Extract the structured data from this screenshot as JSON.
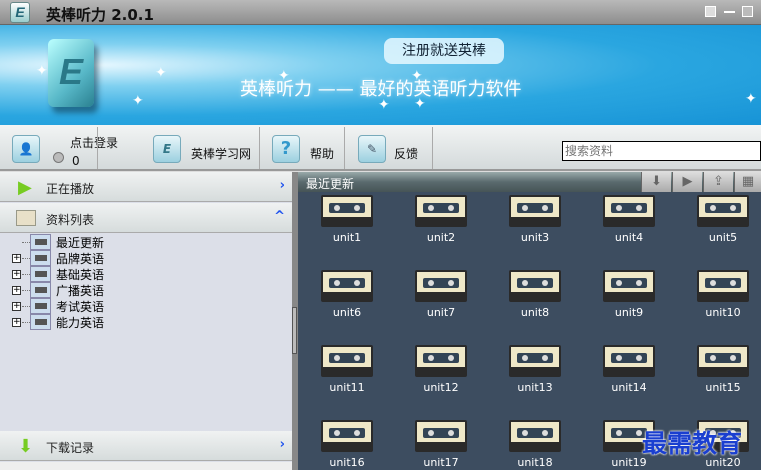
{
  "window": {
    "title": "英棒听力 2.0.1"
  },
  "banner": {
    "promo": "注册就送英棒",
    "slogan": "英棒听力 —— 最好的英语听力软件"
  },
  "toolbar": {
    "login": "点击登录",
    "coins": "0",
    "site": "英棒学习网",
    "help": "帮助",
    "feedback": "反馈",
    "search_placeholder": "搜索资料"
  },
  "left": {
    "now_playing": "正在播放",
    "resource_list": "资料列表",
    "downloads": "下载记录",
    "tree": [
      "最近更新",
      "品牌英语",
      "基础英语",
      "广播英语",
      "考试英语",
      "能力英语"
    ]
  },
  "right": {
    "title": "最近更新",
    "units": [
      "unit1",
      "unit2",
      "unit3",
      "unit4",
      "unit5",
      "unit6",
      "unit7",
      "unit8",
      "unit9",
      "unit10",
      "unit11",
      "unit12",
      "unit13",
      "unit14",
      "unit15",
      "unit16",
      "unit17",
      "unit18",
      "unit19",
      "unit20"
    ]
  },
  "watermark": "最需教育"
}
